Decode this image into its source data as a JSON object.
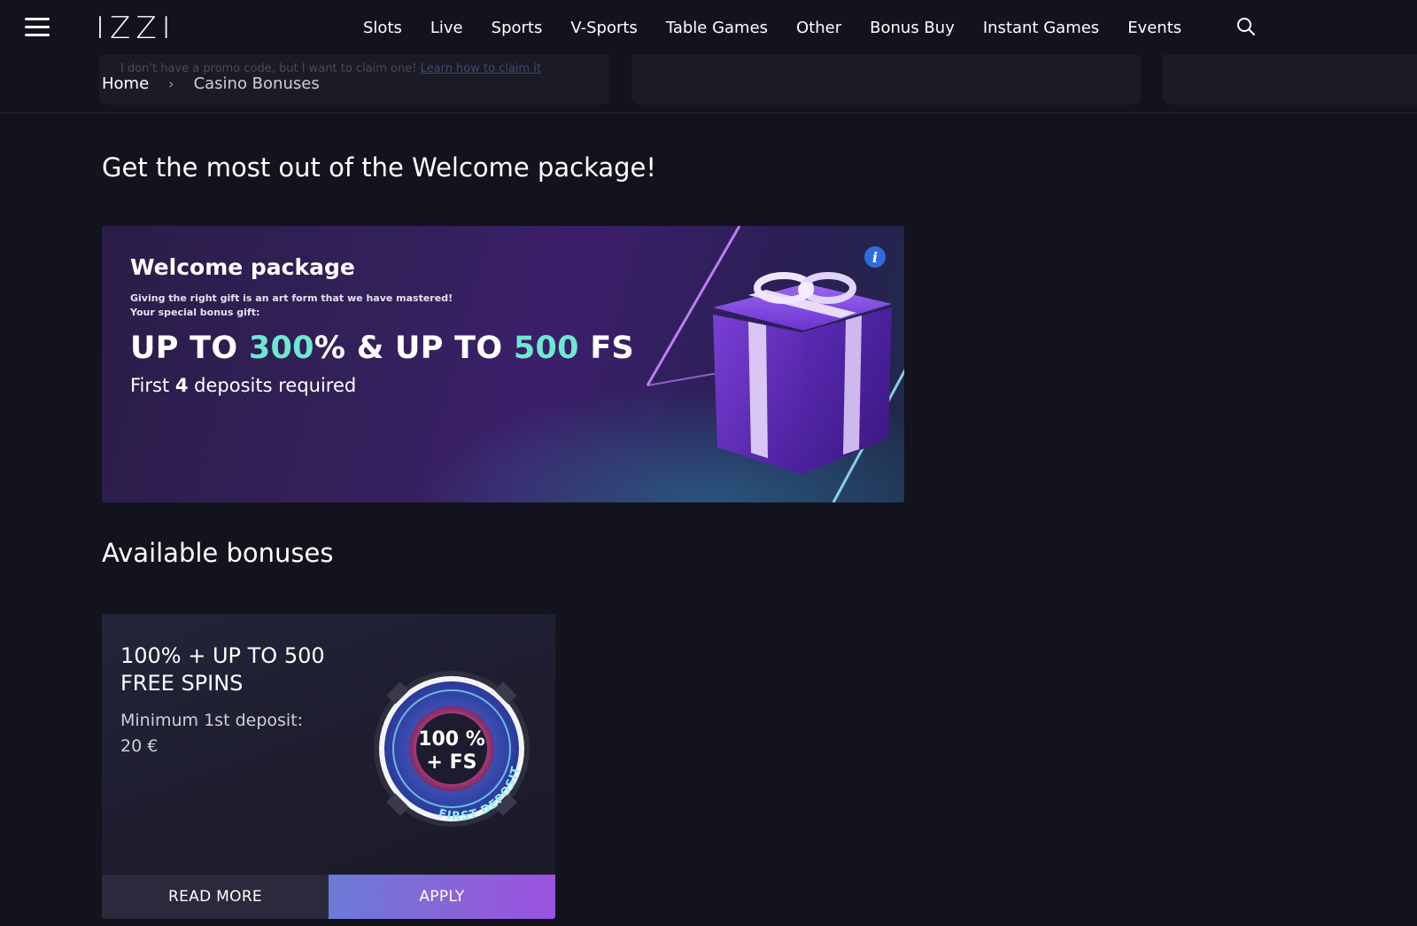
{
  "header": {
    "logo": "IZZI",
    "nav": [
      "Slots",
      "Live",
      "Sports",
      "V-Sports",
      "Table Games",
      "Other",
      "Bonus Buy",
      "Instant Games",
      "Events"
    ]
  },
  "promo_strip": {
    "text": "I don't have a promo code, but I want to claim one!",
    "link": "Learn how to claim it"
  },
  "breadcrumb": {
    "home": "Home",
    "separator": "›",
    "current": "Casino Bonuses"
  },
  "page_title": "Get the most out of the Welcome package!",
  "welcome": {
    "title": "Welcome package",
    "desc_line1": "Giving the right gift is an art form that we have mastered!",
    "desc_line2": "Your special bonus gift:",
    "offer_part1": "UP TO ",
    "offer_hl1": "300",
    "offer_part2": "% & UP TO ",
    "offer_hl2": "500",
    "offer_part3": " FS",
    "req_pre": "First ",
    "req_num": "4",
    "req_post": " deposits required",
    "info_icon": "info-icon"
  },
  "available_title": "Available bonuses",
  "bonus_card": {
    "title": "100% + UP TO 500 FREE SPINS",
    "min_deposit": "Minimum 1st deposit: 20 €",
    "chip_line1": "100 %",
    "chip_line2": "+ FS",
    "chip_ring": "FIRST DEPOSIT",
    "read_more": "READ MORE",
    "apply": "APPLY"
  },
  "colors": {
    "background": "#13131d",
    "accent_teal": "#6ee8d2",
    "apply_gradient_start": "#6b7bd6",
    "apply_gradient_end": "#9a52e0"
  }
}
